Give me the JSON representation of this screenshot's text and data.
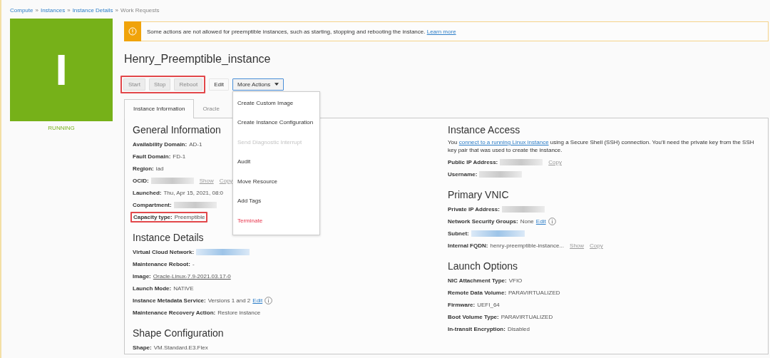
{
  "breadcrumb": [
    {
      "label": "Compute",
      "kind": "link"
    },
    {
      "label": "»",
      "kind": "separator"
    },
    {
      "label": "Instances",
      "kind": "link"
    },
    {
      "label": "»",
      "kind": "separator"
    },
    {
      "label": "Instance Details",
      "kind": "link"
    },
    {
      "label": "»",
      "kind": "separator"
    },
    {
      "label": "Work Requests",
      "kind": "current"
    }
  ],
  "instance_tile": {
    "letter": "I",
    "status": "RUNNING"
  },
  "alert": {
    "message": "Some actions are not allowed for preemptible instances, such as starting, stopping and rebooting the instance.",
    "link": "Learn more"
  },
  "title": "Henry_Preemptible_instance",
  "buttons": [
    {
      "label": "Start",
      "disabled": true,
      "highlighted": true
    },
    {
      "label": "Stop",
      "disabled": true,
      "highlighted": true
    },
    {
      "label": "Reboot",
      "disabled": true,
      "highlighted": true
    },
    {
      "label": "Edit",
      "disabled": false,
      "highlighted": false
    }
  ],
  "more_actions": {
    "label": "More Actions",
    "expanded": true,
    "menu": [
      {
        "label": "Create Custom Image",
        "disabled": false,
        "destructive": false
      },
      {
        "label": "Create Instance Configuration",
        "disabled": false,
        "destructive": false
      },
      {
        "label": "Send Diagnostic Interrupt",
        "disabled": true,
        "destructive": false
      },
      {
        "label": "Audit",
        "disabled": false,
        "destructive": false
      },
      {
        "label": "Move Resource",
        "disabled": false,
        "destructive": false
      },
      {
        "label": "Add Tags",
        "disabled": false,
        "destructive": false
      },
      {
        "label": "Terminate",
        "disabled": false,
        "destructive": true
      }
    ]
  },
  "tabs": [
    {
      "label": "Instance Information",
      "selected": true
    },
    {
      "label": "Oracle",
      "selected": false
    }
  ],
  "left_sections": [
    {
      "heading": "General Information",
      "fields": [
        {
          "label": "Availability Domain:",
          "kind": "text",
          "value": "AD-1"
        },
        {
          "label": "Fault Domain:",
          "kind": "text",
          "value": "FD-1"
        },
        {
          "label": "Region:",
          "kind": "text",
          "value": "iad"
        },
        {
          "label": "OCID:",
          "kind": "redacted",
          "actions": [
            "Show",
            "Copy"
          ]
        },
        {
          "label": "Launched:",
          "kind": "text",
          "value": "Thu, Apr 15, 2021, 08:0"
        },
        {
          "label": "Compartment:",
          "kind": "redacted"
        },
        {
          "label": "Capacity type:",
          "kind": "text",
          "value": "Preemptible",
          "highlighted": true
        }
      ]
    },
    {
      "heading": "Instance Details",
      "fields": [
        {
          "label": "Virtual Cloud Network:",
          "kind": "redacted_link"
        },
        {
          "label": "Maintenance Reboot:",
          "kind": "text",
          "value": "-"
        },
        {
          "label": "Image:",
          "kind": "link",
          "value": "Oracle-Linux-7.9-2021.03.17-0"
        },
        {
          "label": "Launch Mode:",
          "kind": "text",
          "value": "NATIVE"
        },
        {
          "label": "Instance Metadata Service:",
          "kind": "text",
          "value": "Versions 1 and 2",
          "edit": "Edit",
          "info": true
        },
        {
          "label": "Maintenance Recovery Action:",
          "kind": "text",
          "value": "Restore instance"
        }
      ]
    },
    {
      "heading": "Shape Configuration",
      "fields": [
        {
          "label": "Shape:",
          "kind": "text",
          "value": "VM.Standard.E3.Flex"
        }
      ]
    }
  ],
  "right_sections": [
    {
      "heading": "Instance Access",
      "intro": {
        "before": "You ",
        "link": "connect to a running Linux instance",
        "after": " using a Secure Shell (SSH) connection. You'll need the private key from the SSH key pair that was used to create the instance."
      },
      "fields": [
        {
          "label": "Public IP Address:",
          "kind": "redacted",
          "actions": [
            "Copy"
          ]
        },
        {
          "label": "Username:",
          "kind": "redacted"
        }
      ]
    },
    {
      "heading": "Primary VNIC",
      "fields": [
        {
          "label": "Private IP Address:",
          "kind": "redacted"
        },
        {
          "label": "Network Security Groups:",
          "kind": "text",
          "value": "None",
          "edit": "Edit",
          "info": true
        },
        {
          "label": "Subnet:",
          "kind": "redacted_link"
        },
        {
          "label": "Internal FQDN:",
          "kind": "text",
          "value": "henry-preemptible-instance...",
          "actions": [
            "Show",
            "Copy"
          ]
        }
      ]
    },
    {
      "heading": "Launch Options",
      "fields": [
        {
          "label": "NIC Attachment Type:",
          "kind": "text",
          "value": "VFIO"
        },
        {
          "label": "Remote Data Volume:",
          "kind": "text",
          "value": "PARAVIRTUALIZED"
        },
        {
          "label": "Firmware:",
          "kind": "text",
          "value": "UEFI_64"
        },
        {
          "label": "Boot Volume Type:",
          "kind": "text",
          "value": "PARAVIRTUALIZED"
        },
        {
          "label": "In-transit Encryption:",
          "kind": "text",
          "value": "Disabled"
        }
      ]
    }
  ]
}
